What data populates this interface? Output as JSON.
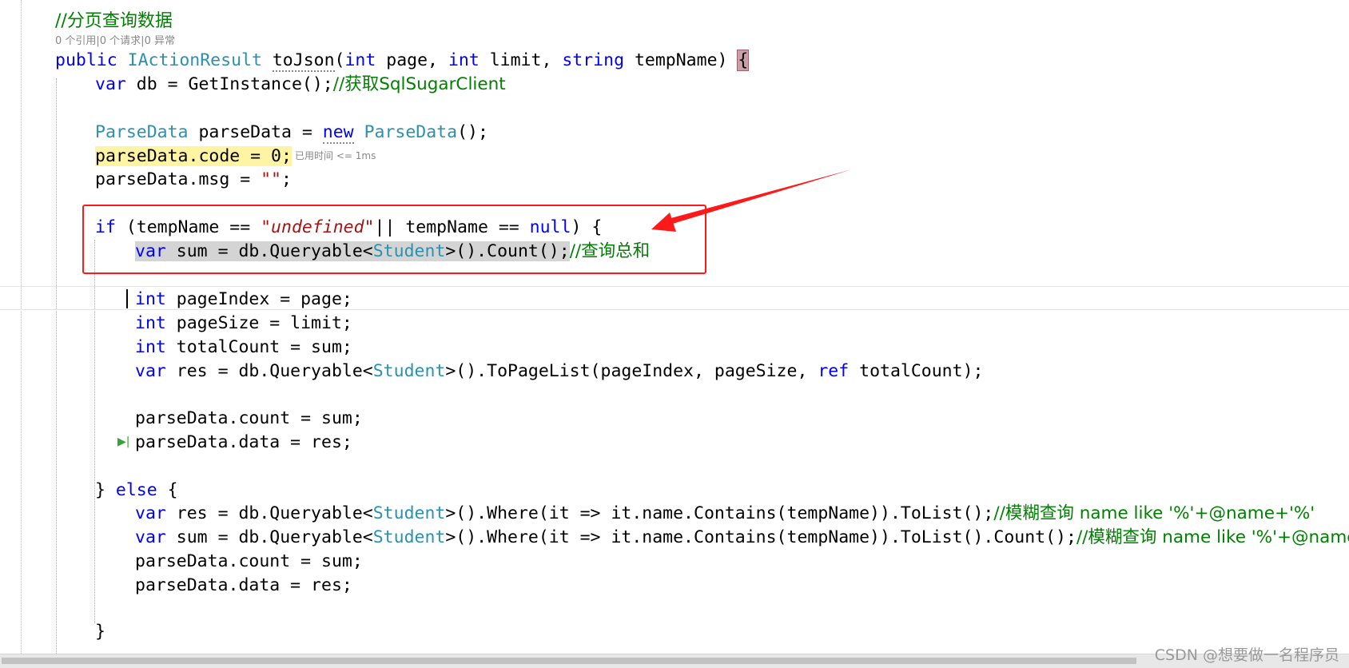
{
  "header_comment": "//分页查询数据",
  "codelens": "0 个引用|0 个请求|0 异常",
  "perf_tip": "已用时间 <= 1ms",
  "code": {
    "l1_kw1": "public",
    "l1_ty": "IActionResult",
    "l1_fn": "toJson",
    "l1_p1": "(",
    "l1_kw2": "int",
    "l1_p2": " page, ",
    "l1_kw3": "int",
    "l1_p3": " limit, ",
    "l1_kw4": "string",
    "l1_p4": " tempName) ",
    "l1_brace": "{",
    "l2_kw": "var",
    "l2_rest": " db = GetInstance();",
    "l2_cm": "//获取SqlSugarClient",
    "l3_ty1": "ParseData",
    "l3_mid": " parseData = ",
    "l3_kw": "new",
    "l3_ty2": "ParseData",
    "l3_end": "();",
    "l4": "parseData.code = 0;",
    "l5_a": "parseData.msg = ",
    "l5_str": "\"\"",
    "l5_b": ";",
    "l6_kw": "if",
    "l6_a": " (tempName == ",
    "l6_str": "\"undefined\"",
    "l6_b": "|| tempName == ",
    "l6_kw2": "null",
    "l6_c": ") {",
    "l7_kw": "var",
    "l7_a": " sum = db.Queryable<",
    "l7_ty": "Student",
    "l7_b": ">().Count();",
    "l7_cm": "//查询总和",
    "l8_kw": "int",
    "l8_a": " pageIndex = page;",
    "l9_kw": "int",
    "l9_a": " pageSize = limit;",
    "l10_kw": "int",
    "l10_a": " totalCount = sum;",
    "l11_kw": "var",
    "l11_a": " res = db.Queryable<",
    "l11_ty": "Student",
    "l11_b": ">().ToPageList(pageIndex, pageSize, ",
    "l11_kw2": "ref",
    "l11_c": " totalCount);",
    "l12": "parseData.count = sum;",
    "l13": "parseData.data = res;",
    "l14_a": "} ",
    "l14_kw": "else",
    "l14_b": " {",
    "l15_kw": "var",
    "l15_a": " res = db.Queryable<",
    "l15_ty": "Student",
    "l15_b": ">().Where(it => it.name.Contains(tempName)).ToList();",
    "l15_cm": "//模糊查询 name like '%'+@name+'%'",
    "l16_kw": "var",
    "l16_a": " sum = db.Queryable<",
    "l16_ty": "Student",
    "l16_b": ">().Where(it => it.name.Contains(tempName)).ToList().Count();",
    "l16_cm": "//模糊查询 name like '%'+@name+'%'",
    "l17": "parseData.count = sum;",
    "l18": "parseData.data = res;",
    "l19": "}"
  },
  "watermark": "CSDN @想要做一名程序员",
  "colors": {
    "keyword": "#0000ff",
    "type": "#2b91af",
    "string": "#a31515",
    "comment": "#008000",
    "annotation": "#ff1a1a"
  }
}
